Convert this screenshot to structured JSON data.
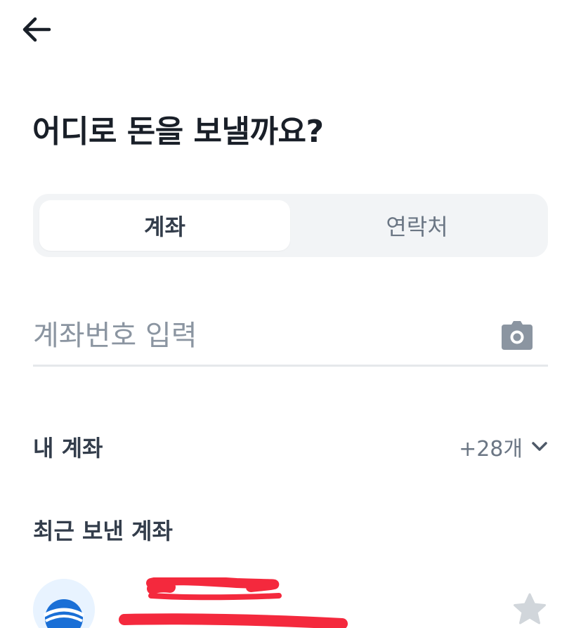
{
  "header": {
    "back_icon": "arrow-left-icon"
  },
  "page": {
    "title": "어디로 돈을 보낼까요?"
  },
  "tabs": [
    {
      "label": "계좌",
      "active": true
    },
    {
      "label": "연락처",
      "active": false
    }
  ],
  "account_input": {
    "placeholder": "계좌번호 입력",
    "value": "",
    "scan_icon": "camera-icon"
  },
  "my_accounts": {
    "title": "내 계좌",
    "count_label": "+28개",
    "toggle_icon": "chevron-down-icon"
  },
  "recent": {
    "title": "최근 보낸 계좌",
    "items": [
      {
        "name": "",
        "redacted": true,
        "favorite_icon": "star-icon"
      }
    ]
  },
  "colors": {
    "text_primary": "#191f28",
    "text_secondary": "#6b7684",
    "placeholder": "#8b95a1",
    "segment_bg": "#f2f4f6",
    "divider": "#e5e8eb",
    "star_inactive": "#d1d6db",
    "redaction": "#f4293d",
    "bank_blue": "#1a73e8"
  }
}
